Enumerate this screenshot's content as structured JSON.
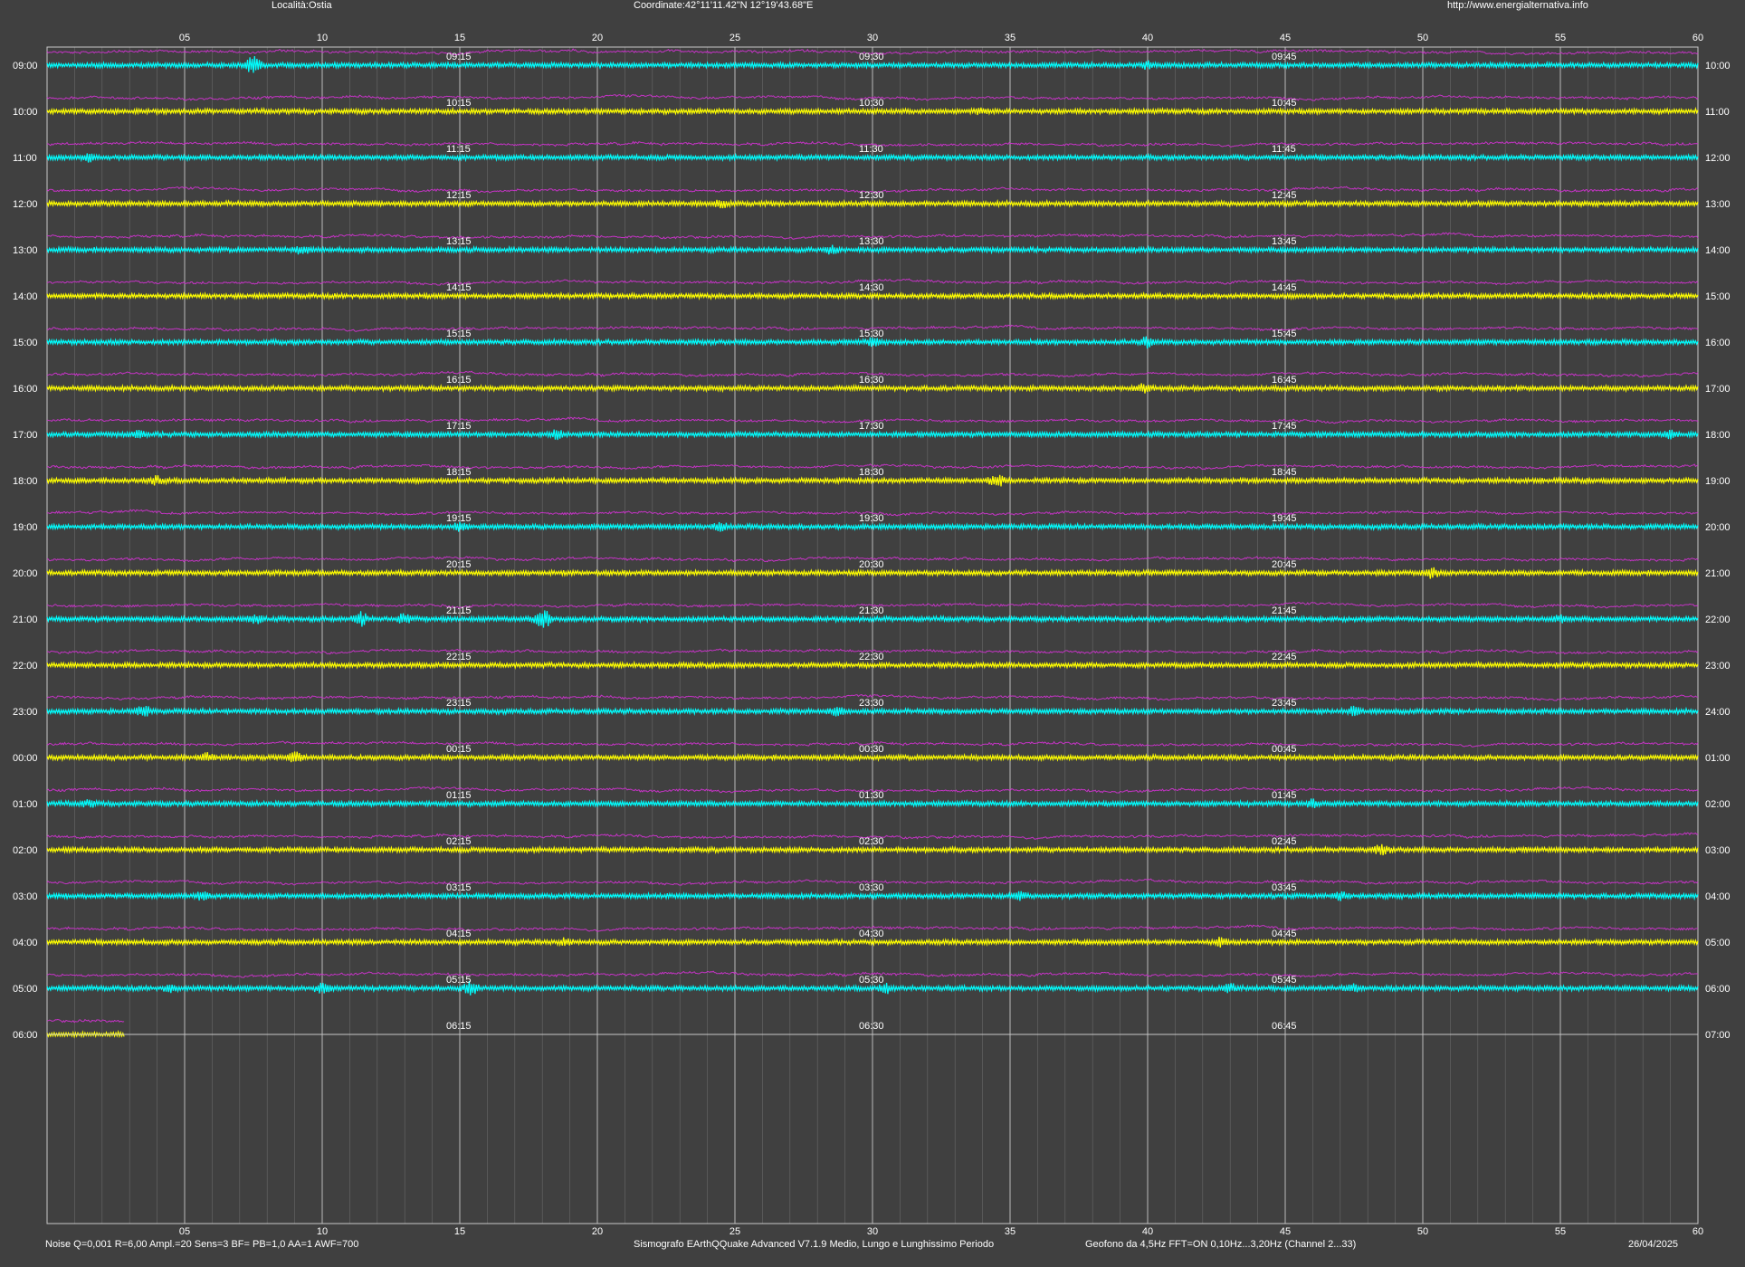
{
  "header": {
    "location": "Località:Ostia",
    "coordinates": "Coordinate:42°11'11.42\"N  12°19'43.68\"E",
    "website": "http://www.energialternativa.info"
  },
  "footer": {
    "noise_params": "Noise Q=0,001 R=6,00 Ampl.=20 Sens=3 BF= PB=1,0 AA=1 AWF=700",
    "software": "Sismografo  EArthQQuake Advanced V7.1.9  Medio, Lungo e Lunghissimo Periodo",
    "sensor": "Geofono da 4,5Hz FFT=ON 0,10Hz...3,20Hz      (Channel 2...33)",
    "date": "26/04/2025"
  },
  "colors": {
    "background": "#404040",
    "grid_major": "#c8c8c8",
    "grid_minor": "#8a8a8a",
    "trace_a": "#00ffff",
    "trace_b": "#ffff00",
    "long_period": "#cc33cc",
    "text": "#ffffff"
  },
  "chart_data": {
    "type": "line",
    "x_ticks": [
      "05",
      "10",
      "15",
      "20",
      "25",
      "30",
      "35",
      "40",
      "45",
      "50",
      "55",
      "60"
    ],
    "xlim": [
      0,
      60
    ],
    "rows": [
      {
        "left": "09:00",
        "right": "10:00",
        "marks": [
          "09:15",
          "09:30",
          "09:45"
        ],
        "events": [
          [
            7.5,
            4
          ],
          [
            40,
            1.2
          ]
        ]
      },
      {
        "left": "10:00",
        "right": "11:00",
        "marks": [
          "10:15",
          "10:30",
          "10:45"
        ],
        "events": [
          [
            34,
            1.3
          ]
        ]
      },
      {
        "left": "11:00",
        "right": "12:00",
        "marks": [
          "11:15",
          "11:30",
          "11:45"
        ],
        "events": [
          [
            1.5,
            1.4
          ]
        ]
      },
      {
        "left": "12:00",
        "right": "13:00",
        "marks": [
          "12:15",
          "12:30",
          "12:45"
        ],
        "events": [
          [
            24.5,
            1.3
          ]
        ]
      },
      {
        "left": "13:00",
        "right": "14:00",
        "marks": [
          "13:15",
          "13:30",
          "13:45"
        ],
        "events": [
          [
            9.3,
            1.6
          ],
          [
            28.5,
            1.7
          ]
        ]
      },
      {
        "left": "14:00",
        "right": "15:00",
        "marks": [
          "14:15",
          "14:30",
          "14:45"
        ],
        "events": []
      },
      {
        "left": "15:00",
        "right": "16:00",
        "marks": [
          "15:15",
          "15:30",
          "15:45"
        ],
        "events": [
          [
            30,
            1.6
          ],
          [
            40,
            2.5
          ]
        ]
      },
      {
        "left": "16:00",
        "right": "17:00",
        "marks": [
          "16:15",
          "16:30",
          "16:45"
        ],
        "events": [
          [
            39.8,
            1.6
          ]
        ]
      },
      {
        "left": "17:00",
        "right": "18:00",
        "marks": [
          "17:15",
          "17:30",
          "17:45"
        ],
        "events": [
          [
            3.3,
            1.4
          ],
          [
            18.5,
            2.0
          ],
          [
            59,
            1.5
          ]
        ]
      },
      {
        "left": "18:00",
        "right": "19:00",
        "marks": [
          "18:15",
          "18:30",
          "18:45"
        ],
        "events": [
          [
            4,
            1.6
          ],
          [
            34.5,
            2.5
          ]
        ]
      },
      {
        "left": "19:00",
        "right": "20:00",
        "marks": [
          "19:15",
          "19:30",
          "19:45"
        ],
        "events": [
          [
            15,
            1.4
          ],
          [
            24.5,
            1.3
          ]
        ]
      },
      {
        "left": "20:00",
        "right": "21:00",
        "marks": [
          "20:15",
          "20:30",
          "20:45"
        ],
        "events": [
          [
            50.3,
            2.0
          ]
        ]
      },
      {
        "left": "21:00",
        "right": "22:00",
        "marks": [
          "21:15",
          "21:30",
          "21:45"
        ],
        "events": [
          [
            7.6,
            1.7
          ],
          [
            11.4,
            2.8
          ],
          [
            13,
            2.2
          ],
          [
            18,
            5.0
          ],
          [
            55,
            1.3
          ]
        ]
      },
      {
        "left": "22:00",
        "right": "23:00",
        "marks": [
          "22:15",
          "22:30",
          "22:45"
        ],
        "events": []
      },
      {
        "left": "23:00",
        "right": "24:00",
        "marks": [
          "23:15",
          "23:30",
          "23:45"
        ],
        "events": [
          [
            3.5,
            2.2
          ],
          [
            28.7,
            1.6
          ],
          [
            47.5,
            1.7
          ]
        ]
      },
      {
        "left": "00:00",
        "right": "01:00",
        "marks": [
          "00:15",
          "00:30",
          "00:45"
        ],
        "events": [
          [
            5.8,
            1.6
          ],
          [
            9,
            2.0
          ]
        ]
      },
      {
        "left": "01:00",
        "right": "02:00",
        "marks": [
          "01:15",
          "01:30",
          "01:45"
        ],
        "events": [
          [
            1.5,
            1.3
          ],
          [
            46,
            1.5
          ]
        ]
      },
      {
        "left": "02:00",
        "right": "03:00",
        "marks": [
          "02:15",
          "02:30",
          "02:45"
        ],
        "events": [
          [
            48.5,
            1.8
          ]
        ]
      },
      {
        "left": "03:00",
        "right": "04:00",
        "marks": [
          "03:15",
          "03:30",
          "03:45"
        ],
        "events": [
          [
            5.6,
            1.6
          ],
          [
            35.3,
            1.8
          ],
          [
            47,
            1.9
          ]
        ]
      },
      {
        "left": "04:00",
        "right": "05:00",
        "marks": [
          "04:15",
          "04:30",
          "04:45"
        ],
        "events": [
          [
            18.8,
            1.4
          ],
          [
            42.7,
            1.9
          ]
        ]
      },
      {
        "left": "05:00",
        "right": "06:00",
        "marks": [
          "05:15",
          "05:30",
          "05:45"
        ],
        "events": [
          [
            4.5,
            1.6
          ],
          [
            10,
            2.1
          ],
          [
            15.4,
            2.7
          ],
          [
            30.5,
            2.0
          ],
          [
            43,
            1.6
          ],
          [
            47.5,
            1.4
          ]
        ]
      },
      {
        "left": "06:00",
        "right": "07:00",
        "marks": [
          "06:15",
          "06:30",
          "06:45"
        ],
        "events": [],
        "end_minute": 2.8
      }
    ]
  }
}
